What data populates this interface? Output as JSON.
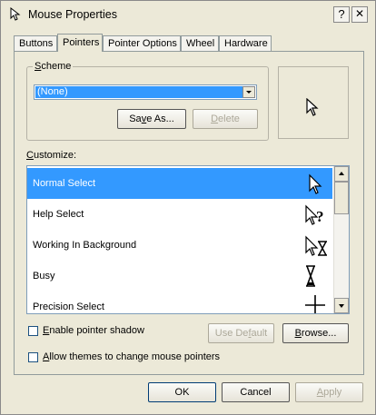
{
  "window": {
    "title": "Mouse Properties",
    "title_icon": "mouse-icon",
    "help_glyph": "?",
    "close_glyph": "✕"
  },
  "tabs": [
    {
      "label": "Buttons"
    },
    {
      "label": "Pointers",
      "active": true
    },
    {
      "label": "Pointer Options"
    },
    {
      "label": "Wheel"
    },
    {
      "label": "Hardware"
    }
  ],
  "scheme": {
    "legend_pre": "",
    "legend_u": "S",
    "legend_post": "cheme",
    "value": "(None)",
    "save_as_pre": "Sa",
    "save_as_u": "v",
    "save_as_post": "e As...",
    "delete_pre": "",
    "delete_u": "D",
    "delete_post": "elete"
  },
  "preview": {
    "icon": "arrow-cursor-icon"
  },
  "customize": {
    "label_pre": "",
    "label_u": "C",
    "label_post": "ustomize:",
    "items": [
      {
        "label": "Normal Select",
        "icon": "arrow-cursor-icon",
        "selected": true
      },
      {
        "label": "Help Select",
        "icon": "help-cursor-icon",
        "selected": false
      },
      {
        "label": "Working In Background",
        "icon": "working-cursor-icon",
        "selected": false
      },
      {
        "label": "Busy",
        "icon": "hourglass-cursor-icon",
        "selected": false
      },
      {
        "label": "Precision Select",
        "icon": "crosshair-cursor-icon",
        "selected": false
      }
    ]
  },
  "options": {
    "shadow_pre": "",
    "shadow_u": "E",
    "shadow_post": "nable pointer shadow",
    "shadow_checked": false,
    "themes_pre": "",
    "themes_u": "A",
    "themes_post": "llow themes to change mouse pointers",
    "themes_checked": false,
    "use_default_pre": "Use De",
    "use_default_u": "f",
    "use_default_post": "ault",
    "browse_pre": "",
    "browse_u": "B",
    "browse_post": "rowse..."
  },
  "footer": {
    "ok": "OK",
    "cancel": "Cancel",
    "apply_pre": "",
    "apply_u": "A",
    "apply_post": "pply"
  }
}
